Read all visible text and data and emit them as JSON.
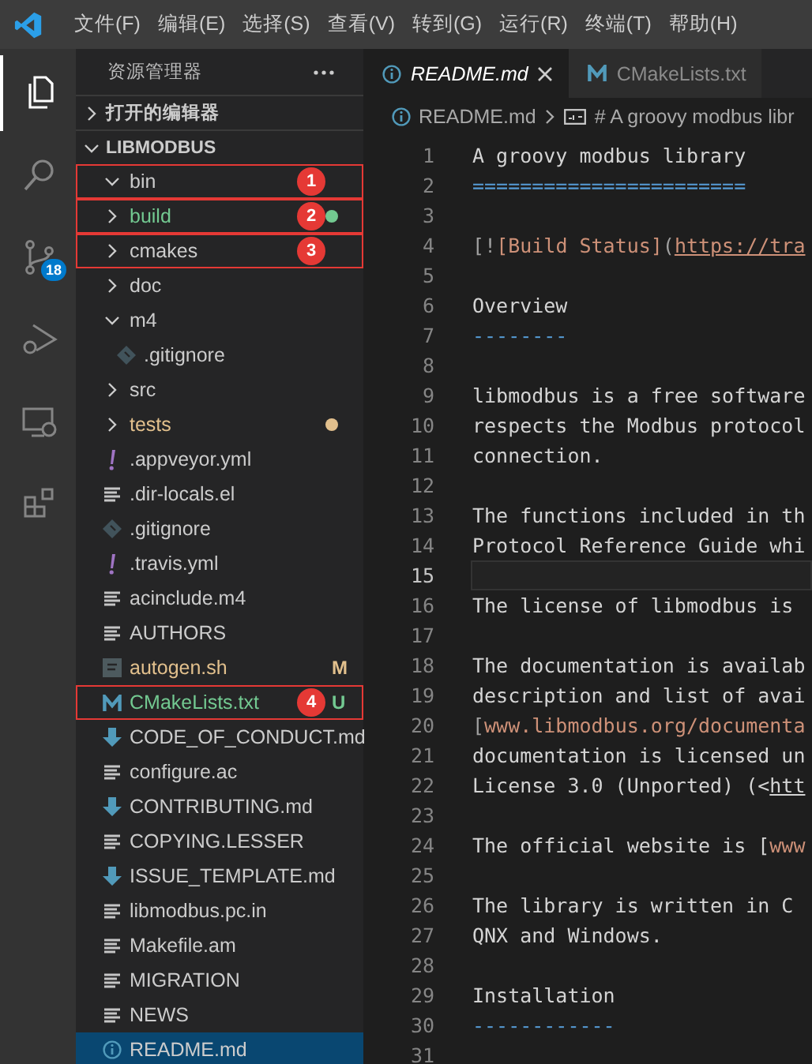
{
  "menu": [
    "文件(F)",
    "编辑(E)",
    "选择(S)",
    "查看(V)",
    "转到(G)",
    "运行(R)",
    "终端(T)",
    "帮助(H)"
  ],
  "activity_bar": [
    {
      "kind": "explorer",
      "selected": true
    },
    {
      "kind": "search",
      "selected": false
    },
    {
      "kind": "source-control",
      "selected": false,
      "badge": "18"
    },
    {
      "kind": "debug",
      "selected": false
    },
    {
      "kind": "remote",
      "selected": false
    },
    {
      "kind": "extensions",
      "selected": false
    }
  ],
  "sidebar": {
    "title": "资源管理器",
    "sections": [
      {
        "label": "打开的编辑器",
        "expanded": false
      },
      {
        "label": "LIBMODBUS",
        "expanded": true
      }
    ]
  },
  "tree": [
    {
      "name": "bin",
      "kind": "folder",
      "expanded": true,
      "selected": false,
      "dot": false,
      "annotation": "1"
    },
    {
      "name": "build",
      "kind": "folder",
      "expanded": false,
      "selected": false,
      "dot": true,
      "color": "#73c991",
      "annotation": "2"
    },
    {
      "name": "cmakes",
      "kind": "folder",
      "expanded": false,
      "selected": false,
      "dot": false,
      "annotation": "3"
    },
    {
      "name": "doc",
      "kind": "folder",
      "expanded": false,
      "selected": false,
      "dot": false
    },
    {
      "name": "m4",
      "kind": "folder",
      "expanded": true,
      "selected": false,
      "dot": false,
      "children": [
        {
          "name": ".gitignore",
          "kind": "git",
          "selected": false,
          "dot": false
        }
      ]
    },
    {
      "name": "src",
      "kind": "folder",
      "expanded": false,
      "selected": false,
      "dot": false
    },
    {
      "name": "tests",
      "kind": "folder",
      "expanded": false,
      "selected": false,
      "dot": true,
      "color": "#e2c08d"
    },
    {
      "name": ".appveyor.yml",
      "kind": "yaml",
      "selected": false,
      "dot": false
    },
    {
      "name": ".dir-locals.el",
      "kind": "text",
      "selected": false,
      "dot": false
    },
    {
      "name": ".gitignore",
      "kind": "git",
      "selected": false,
      "dot": false
    },
    {
      "name": ".travis.yml",
      "kind": "yaml",
      "selected": false,
      "dot": false
    },
    {
      "name": "acinclude.m4",
      "kind": "text",
      "selected": false,
      "dot": false
    },
    {
      "name": "AUTHORS",
      "kind": "text",
      "selected": false,
      "dot": false
    },
    {
      "name": "autogen.sh",
      "kind": "shell",
      "selected": false,
      "dot": false,
      "color": "#e2c08d",
      "badge": "M"
    },
    {
      "name": "CMakeLists.txt",
      "kind": "cmake",
      "selected": false,
      "dot": false,
      "color": "#73c991",
      "badge": "U",
      "annotation": "4"
    },
    {
      "name": "CODE_OF_CONDUCT.md",
      "kind": "markdown",
      "selected": false,
      "dot": false
    },
    {
      "name": "configure.ac",
      "kind": "text",
      "selected": false,
      "dot": false
    },
    {
      "name": "CONTRIBUTING.md",
      "kind": "markdown",
      "selected": false,
      "dot": false
    },
    {
      "name": "COPYING.LESSER",
      "kind": "text",
      "selected": false,
      "dot": false
    },
    {
      "name": "ISSUE_TEMPLATE.md",
      "kind": "markdown",
      "selected": false,
      "dot": false
    },
    {
      "name": "libmodbus.pc.in",
      "kind": "text",
      "selected": false,
      "dot": false
    },
    {
      "name": "Makefile.am",
      "kind": "text",
      "selected": false,
      "dot": false
    },
    {
      "name": "MIGRATION",
      "kind": "text",
      "selected": false,
      "dot": false
    },
    {
      "name": "NEWS",
      "kind": "text",
      "selected": false,
      "dot": false
    },
    {
      "name": "README.md",
      "kind": "info",
      "selected": true,
      "dot": false
    }
  ],
  "tabs": [
    {
      "label": "README.md",
      "kind": "info",
      "selected": true,
      "preview": true
    },
    {
      "label": "CMakeLists.txt",
      "kind": "cmake",
      "selected": false,
      "preview": false
    }
  ],
  "breadcrumb": {
    "file": "README.md",
    "symbol": "# A groovy modbus libr"
  },
  "code_lines": [
    {
      "number": "1",
      "active": false,
      "segments": [
        {
          "kind": "plain",
          "text": "A groovy modbus library"
        }
      ]
    },
    {
      "number": "2",
      "active": false,
      "segments": [
        {
          "kind": "rule",
          "text": "======================="
        }
      ]
    },
    {
      "number": "3",
      "active": false
    },
    {
      "number": "4",
      "active": false,
      "segments": [
        {
          "kind": "punct",
          "text": "[!"
        },
        {
          "kind": "link",
          "text": "[Build Status]"
        },
        {
          "kind": "punct",
          "text": "("
        },
        {
          "kind": "url",
          "text": "https://tra"
        }
      ]
    },
    {
      "number": "5",
      "active": false
    },
    {
      "number": "6",
      "active": false,
      "segments": [
        {
          "kind": "plain",
          "text": "Overview"
        }
      ]
    },
    {
      "number": "7",
      "active": false,
      "segments": [
        {
          "kind": "rule",
          "text": "--------"
        }
      ]
    },
    {
      "number": "8",
      "active": false
    },
    {
      "number": "9",
      "active": false,
      "segments": [
        {
          "kind": "plain",
          "text": "libmodbus is a free software"
        }
      ]
    },
    {
      "number": "10",
      "active": false,
      "segments": [
        {
          "kind": "plain",
          "text": "respects the Modbus protocol"
        }
      ]
    },
    {
      "number": "11",
      "active": false,
      "segments": [
        {
          "kind": "plain",
          "text": "connection."
        }
      ]
    },
    {
      "number": "12",
      "active": false
    },
    {
      "number": "13",
      "active": false,
      "segments": [
        {
          "kind": "plain",
          "text": "The functions included in th"
        }
      ]
    },
    {
      "number": "14",
      "active": false,
      "segments": [
        {
          "kind": "plain",
          "text": "Protocol Reference Guide whi"
        }
      ]
    },
    {
      "number": "15",
      "active": true
    },
    {
      "number": "16",
      "active": false,
      "segments": [
        {
          "kind": "plain",
          "text": "The license of libmodbus is"
        }
      ]
    },
    {
      "number": "17",
      "active": false
    },
    {
      "number": "18",
      "active": false,
      "segments": [
        {
          "kind": "plain",
          "text": "The documentation is availab"
        }
      ]
    },
    {
      "number": "19",
      "active": false,
      "segments": [
        {
          "kind": "plain",
          "text": "description and list of avai"
        }
      ]
    },
    {
      "number": "20",
      "active": false,
      "segments": [
        {
          "kind": "punct",
          "text": "["
        },
        {
          "kind": "link",
          "text": "www.libmodbus.org/documenta"
        }
      ]
    },
    {
      "number": "21",
      "active": false,
      "segments": [
        {
          "kind": "plain",
          "text": "documentation is licensed un"
        }
      ]
    },
    {
      "number": "22",
      "active": false,
      "segments": [
        {
          "kind": "plain",
          "text": "License 3.0 (Unported) (<"
        },
        {
          "kind": "autolink",
          "text": "htt"
        }
      ]
    },
    {
      "number": "23",
      "active": false
    },
    {
      "number": "24",
      "active": false,
      "segments": [
        {
          "kind": "plain",
          "text": "The official website is ["
        },
        {
          "kind": "link",
          "text": "www"
        }
      ]
    },
    {
      "number": "25",
      "active": false
    },
    {
      "number": "26",
      "active": false,
      "segments": [
        {
          "kind": "plain",
          "text": "The library is written in C"
        }
      ]
    },
    {
      "number": "27",
      "active": false,
      "segments": [
        {
          "kind": "plain",
          "text": "QNX and Windows."
        }
      ]
    },
    {
      "number": "28",
      "active": false
    },
    {
      "number": "29",
      "active": false,
      "segments": [
        {
          "kind": "plain",
          "text": "Installation"
        }
      ]
    },
    {
      "number": "30",
      "active": false,
      "segments": [
        {
          "kind": "rule",
          "text": "------------"
        }
      ]
    },
    {
      "number": "31",
      "active": false
    }
  ]
}
